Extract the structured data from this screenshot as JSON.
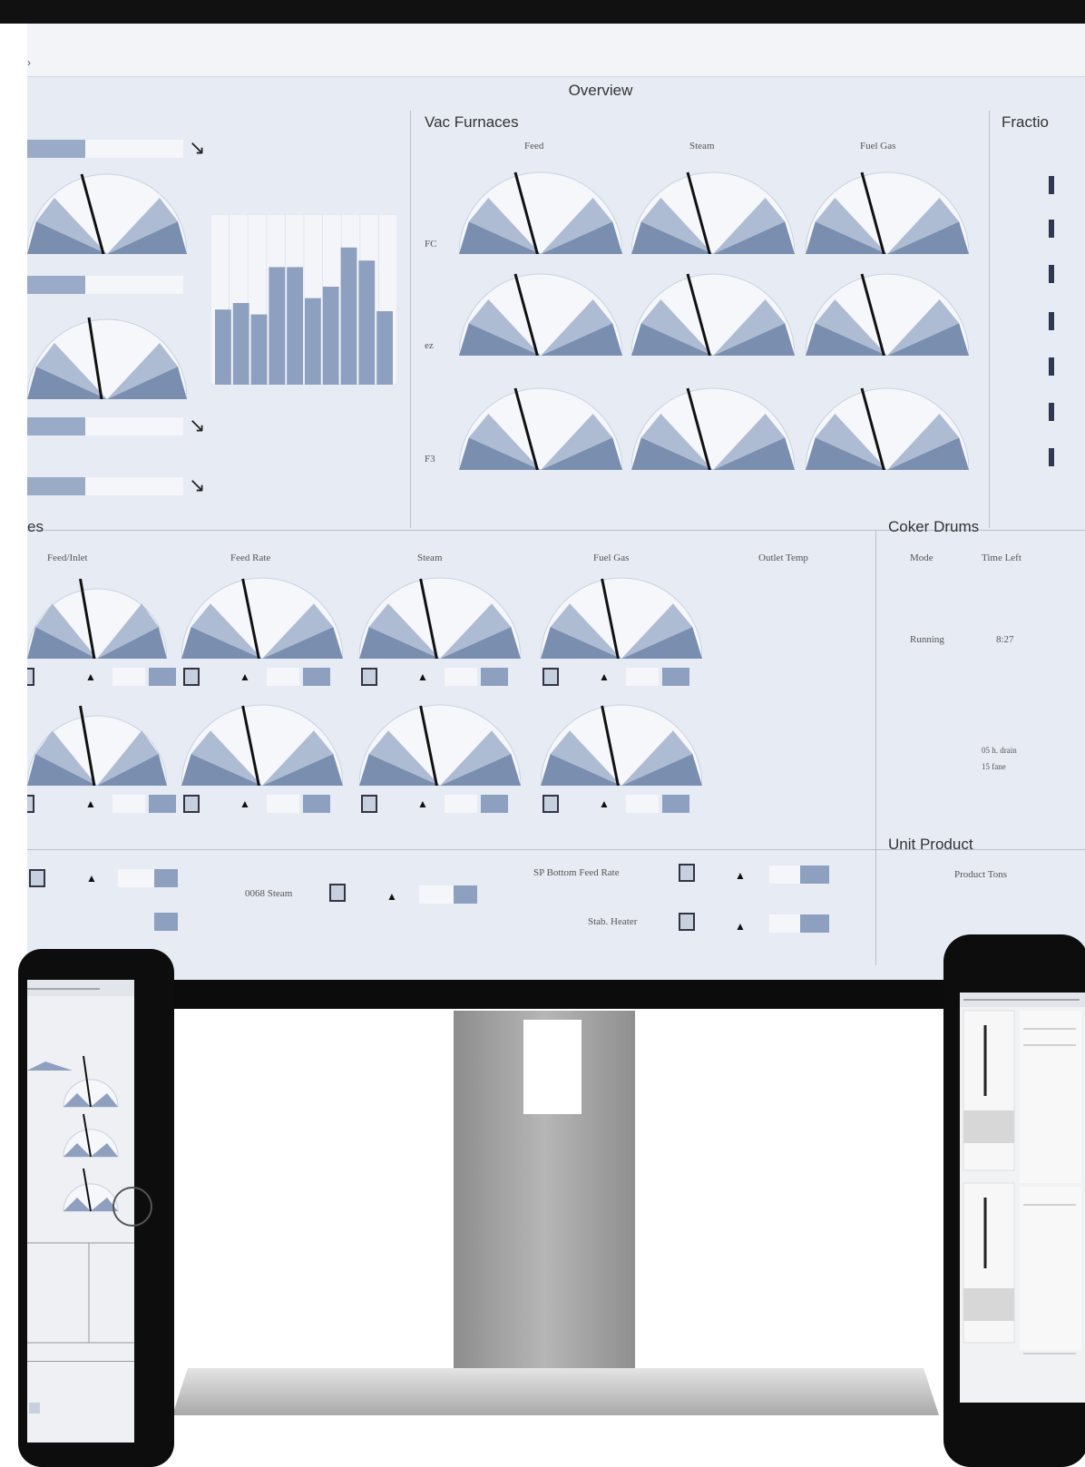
{
  "overview": {
    "title": "Overview",
    "top_left_arrow": "↘"
  },
  "vac_furnaces": {
    "title": "Vac Furnaces",
    "columns": [
      "Feed",
      "Steam",
      "Fuel Gas"
    ],
    "rows": [
      "FC",
      "ez",
      "F3"
    ]
  },
  "fractionator": {
    "title": "Fractio"
  },
  "furnaces_section": {
    "title": "es",
    "columns": [
      "Feed/Inlet",
      "Feed Rate",
      "Steam",
      "Fuel Gas",
      "Outlet Temp"
    ]
  },
  "coker_drums": {
    "title": "Coker Drums",
    "headers": [
      "Mode",
      "Time Left"
    ],
    "mode_value": "Running",
    "time_value": "8:27",
    "notes": [
      "05 h. drain",
      "15 fane"
    ]
  },
  "unit_product": {
    "title": "Unit Product",
    "subheader": "Product Tons"
  },
  "bottom_section": {
    "label_1": "0068 Steam",
    "label_2": "SP Bottom Feed Rate",
    "label_3": "Stab. Heater"
  },
  "bar_chart": {
    "values": [
      46,
      50,
      43,
      72,
      72,
      53,
      60,
      84,
      76,
      45
    ]
  },
  "colors": {
    "accent": "#8ea0bf",
    "gauge_dark": "#7a8fb0",
    "gauge_light": "#b8c6da",
    "background": "#e7ebf3"
  }
}
